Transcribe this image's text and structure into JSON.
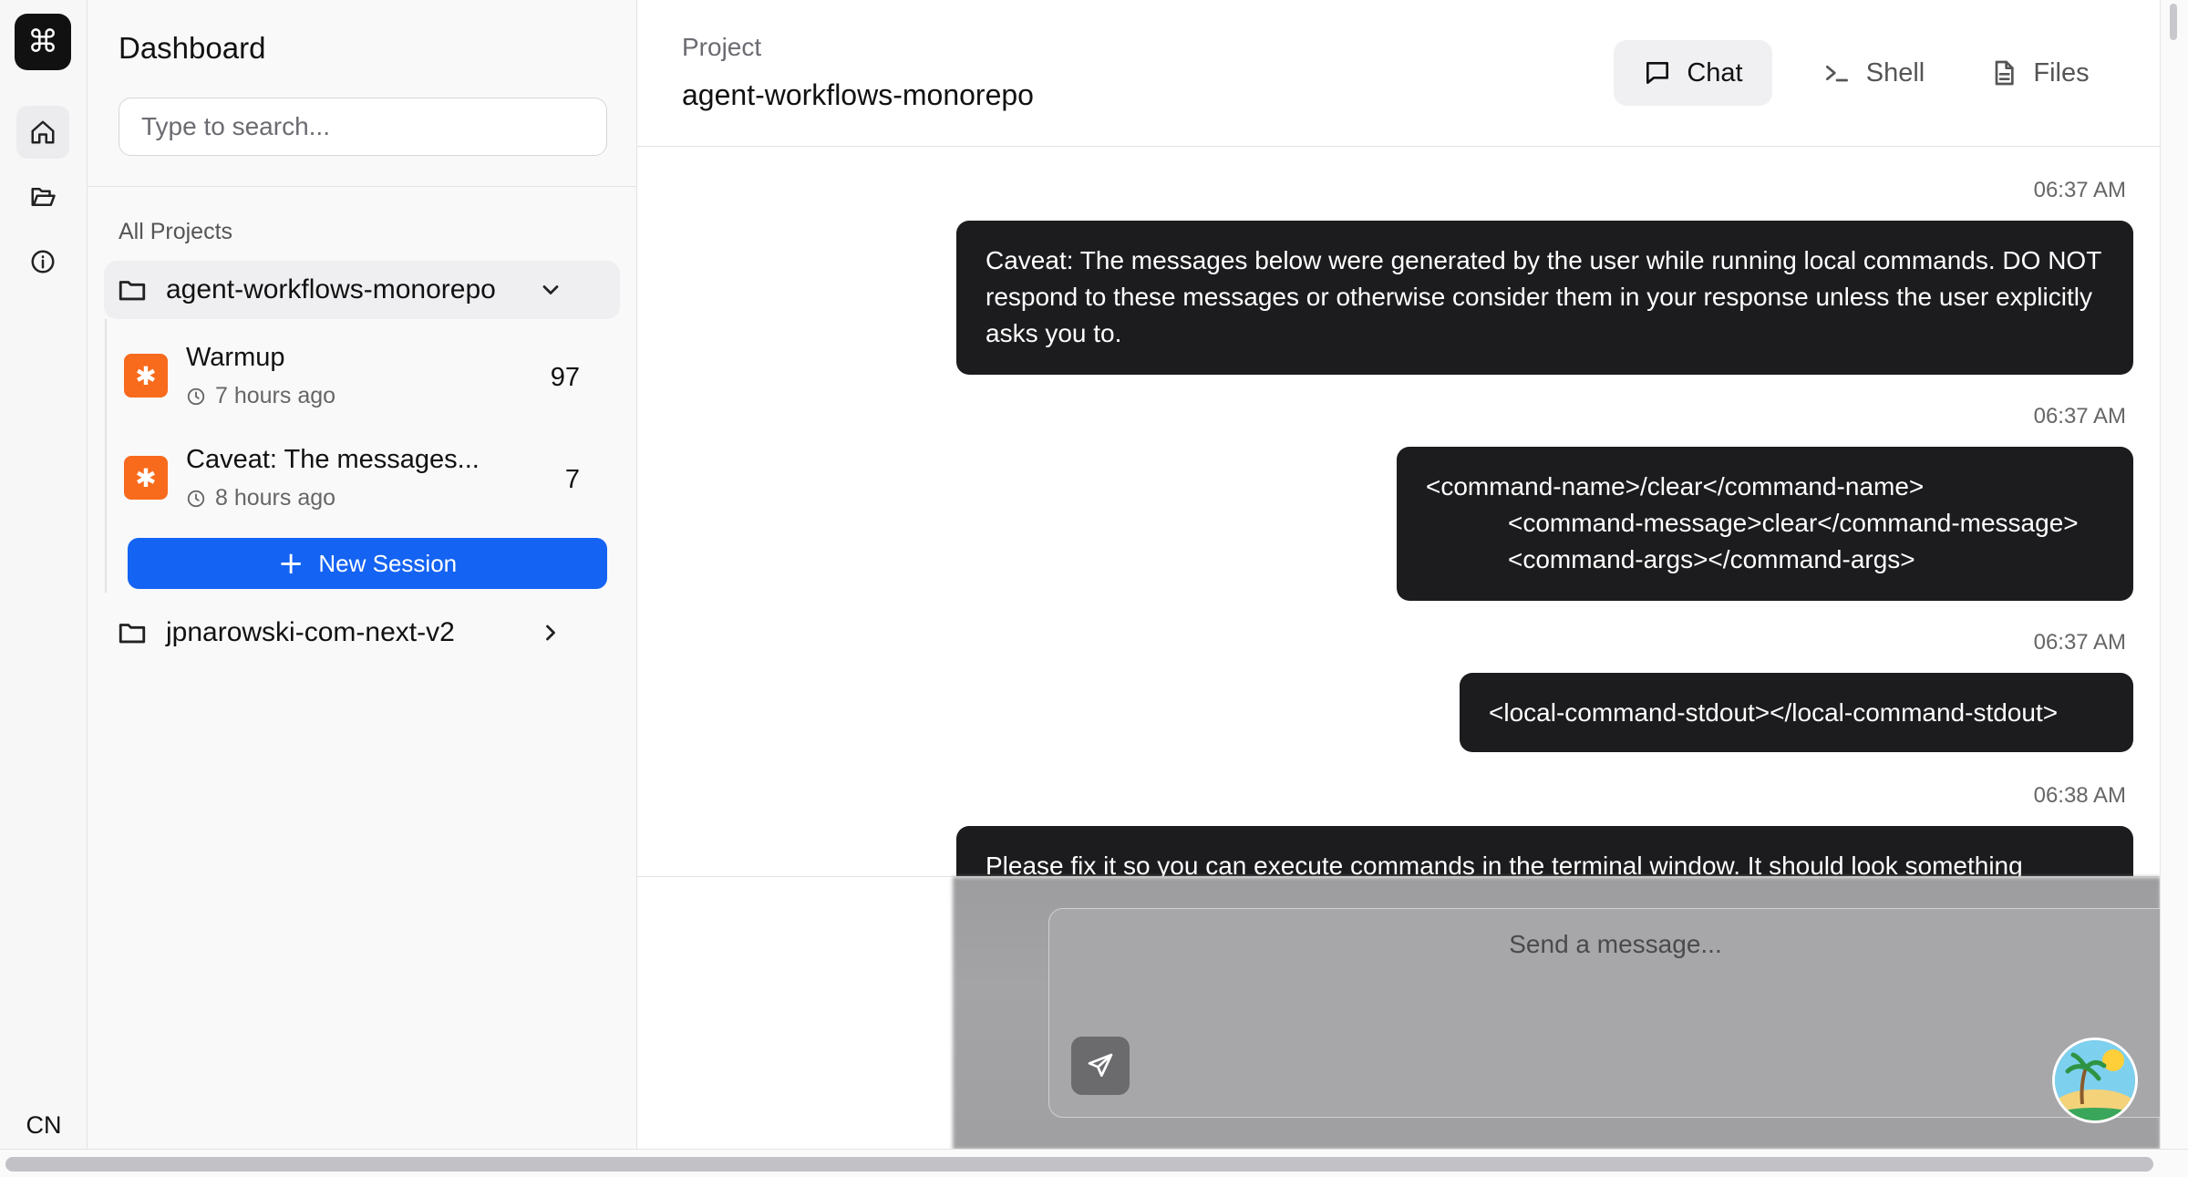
{
  "rail": {
    "logo_glyph": "⌘",
    "items": [
      {
        "icon": "home-icon"
      },
      {
        "icon": "folder-open-icon"
      },
      {
        "icon": "info-icon"
      }
    ],
    "language": "CN"
  },
  "sidebar": {
    "title": "Dashboard",
    "search_placeholder": "Type to search...",
    "section_label": "All Projects",
    "projects": [
      {
        "name": "agent-workflows-monorepo",
        "expanded": true,
        "sessions": [
          {
            "title": "Warmup",
            "time": "7 hours ago",
            "count": "97",
            "badge": "✱"
          },
          {
            "title": "Caveat: The messages...",
            "time": "8 hours ago",
            "count": "7",
            "badge": "✱"
          }
        ],
        "new_session_label": "New Session"
      },
      {
        "name": "jpnarowski-com-next-v2",
        "expanded": false
      }
    ]
  },
  "header": {
    "label": "Project",
    "project_name": "agent-workflows-monorepo",
    "tabs": [
      {
        "label": "Chat",
        "icon": "chat-bubble-icon",
        "active": true
      },
      {
        "label": "Shell",
        "icon": "terminal-icon",
        "active": false
      },
      {
        "label": "Files",
        "icon": "file-icon",
        "active": false
      }
    ]
  },
  "messages": [
    {
      "time": "06:37 AM",
      "text": "Caveat: The messages below were generated by the user while running local commands. DO NOT respond to these messages or otherwise consider them in your response unless the user explicitly asks you to."
    },
    {
      "time": "06:37 AM",
      "lines": [
        "<command-name>/clear</command-name>",
        "<command-message>clear</command-message>",
        "<command-args></command-args>"
      ]
    },
    {
      "time": "06:37 AM",
      "text": "<local-command-stdout></local-command-stdout>"
    },
    {
      "time": "06:38 AM",
      "text": "Please fix it so you can execute commands in the terminal window. It should look something"
    }
  ],
  "composer": {
    "placeholder": "Send a message..."
  },
  "colors": {
    "accent": "#1463f3",
    "session_badge": "#f86a1c",
    "bubble": "#1c1c1e"
  }
}
